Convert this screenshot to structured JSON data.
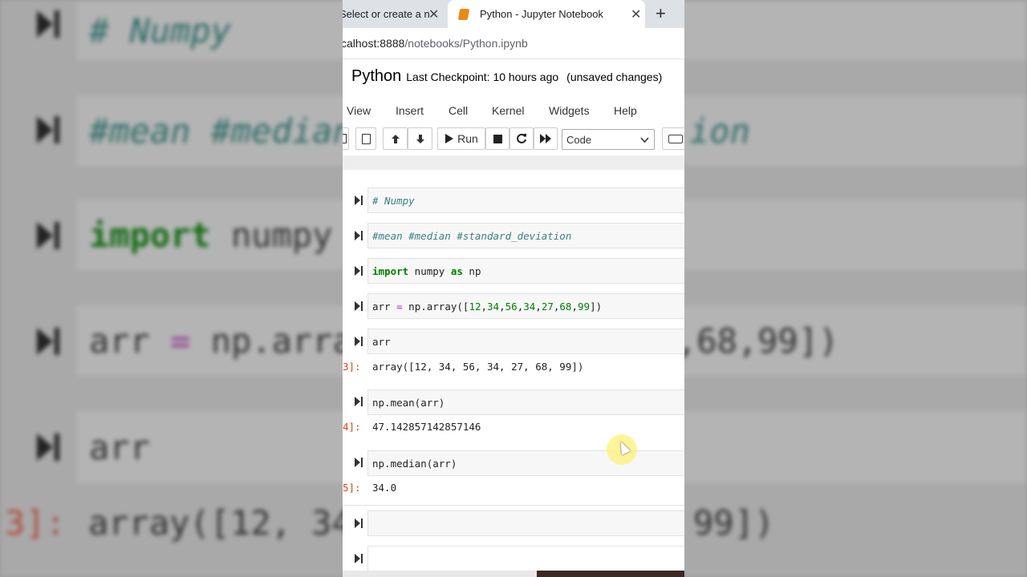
{
  "browser": {
    "tabs": [
      {
        "label": "Select or create a n"
      },
      {
        "label": "Python - Jupyter Notebook"
      }
    ],
    "url_host": "calhost:8888",
    "url_path": "/notebooks/Python.ipynb",
    "new_tab_glyph": "+",
    "close_glyph": "✕"
  },
  "notebook": {
    "name": "Python",
    "checkpoint": "Last Checkpoint: 10 hours ago",
    "status": "(unsaved changes)"
  },
  "menu": [
    "View",
    "Insert",
    "Cell",
    "Kernel",
    "Widgets",
    "Help"
  ],
  "toolbar": {
    "run_label": "Run",
    "cell_type": "Code"
  },
  "cells": {
    "c1": "# Numpy",
    "c2": "#mean #median #standard_deviation",
    "c3_kw1": "import",
    "c3_mid": " numpy ",
    "c3_kw2": "as",
    "c3_end": " np",
    "c4_a": "arr ",
    "c4_op": "=",
    "c4_b": " np.array([",
    "c4_nums": [
      "12",
      "34",
      "56",
      "34",
      "27",
      "68",
      "99"
    ],
    "c4_end": "])",
    "c5": "arr",
    "c5_prompt": "3]:",
    "c5_out": "array([12, 34, 56, 34, 27, 68, 99])",
    "c6": "np.mean(arr)",
    "c6_prompt": "4]:",
    "c6_out": "47.142857142857146",
    "c7": "np.median(arr)",
    "c7_prompt": "5]:",
    "c7_out": "34.0"
  },
  "background": {
    "l1": "# Numpy",
    "l2": "#mean #median",
    "l2_tail": "ion",
    "l3_kw": "import",
    "l3_rest": " numpy ",
    "l4_a": "arr ",
    "l4_op": "=",
    "l4_b": " np.arra",
    "l4_tail": ",68,99])",
    "l5": "arr",
    "l6_prompt": "3]:",
    "l6_out": "array([12, 34",
    "l6_tail": "99])"
  },
  "colors": {
    "accent_orange": "#e98a15",
    "prompt_red": "#d84315",
    "comment_teal": "#408080",
    "keyword_green": "#008000"
  }
}
